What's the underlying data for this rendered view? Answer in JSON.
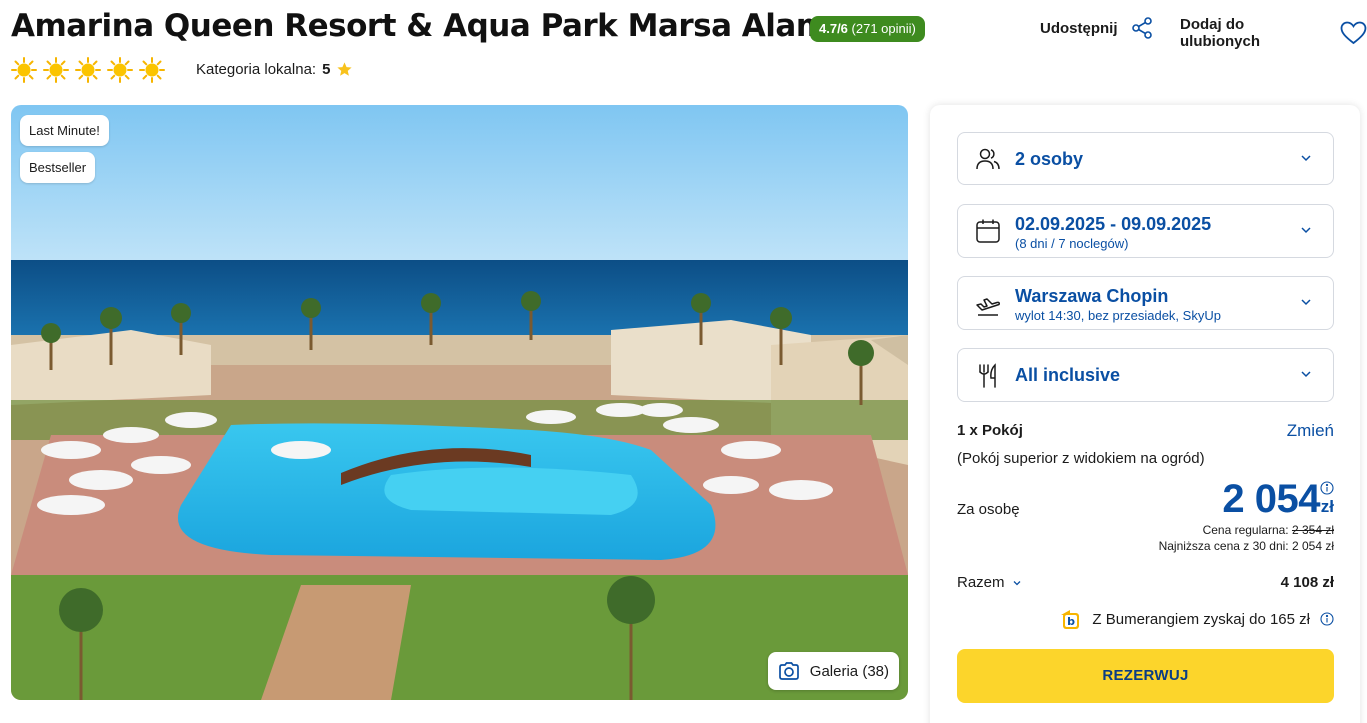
{
  "header": {
    "title": "Amarina Queen Resort & Aqua Park Marsa Alam",
    "rating_score": "4.7/6",
    "rating_count": "(271 opinii)",
    "sun_rating": 5,
    "local_category_label": "Kategoria lokalna:",
    "local_category_value": "5",
    "share_label": "Udostępnij",
    "favorite_label": "Dodaj do ulubionych"
  },
  "gallery": {
    "tags": [
      "Last Minute!",
      "Bestseller"
    ],
    "button_label": "Galeria (38)"
  },
  "booking": {
    "persons": "2 osoby",
    "dates": "02.09.2025 - 09.09.2025",
    "dates_sub": "(8 dni / 7 noclegów)",
    "departure": "Warszawa Chopin",
    "departure_sub": "wylot 14:30, bez przesiadek, SkyUp",
    "board": "All inclusive",
    "room_count": "1 x Pokój",
    "room_change": "Zmień",
    "room_desc": "(Pokój superior z widokiem na ogród)",
    "per_person_label": "Za osobę",
    "price": "2 054",
    "currency": "zł",
    "regular_price_label": "Cena regularna:",
    "regular_price": "2 354 zł",
    "lowest_price_text": "Najniższa cena z 30 dni: 2 054 zł",
    "total_label": "Razem",
    "total_value": "4 108 zł",
    "bumerang_text": "Z Bumerangiem zyskaj do 165 zł",
    "book_button": "REZERWUJ"
  },
  "colors": {
    "accent_blue": "#0a4fa3",
    "rating_green": "#3e8b1f",
    "button_yellow": "#fcd52b"
  }
}
